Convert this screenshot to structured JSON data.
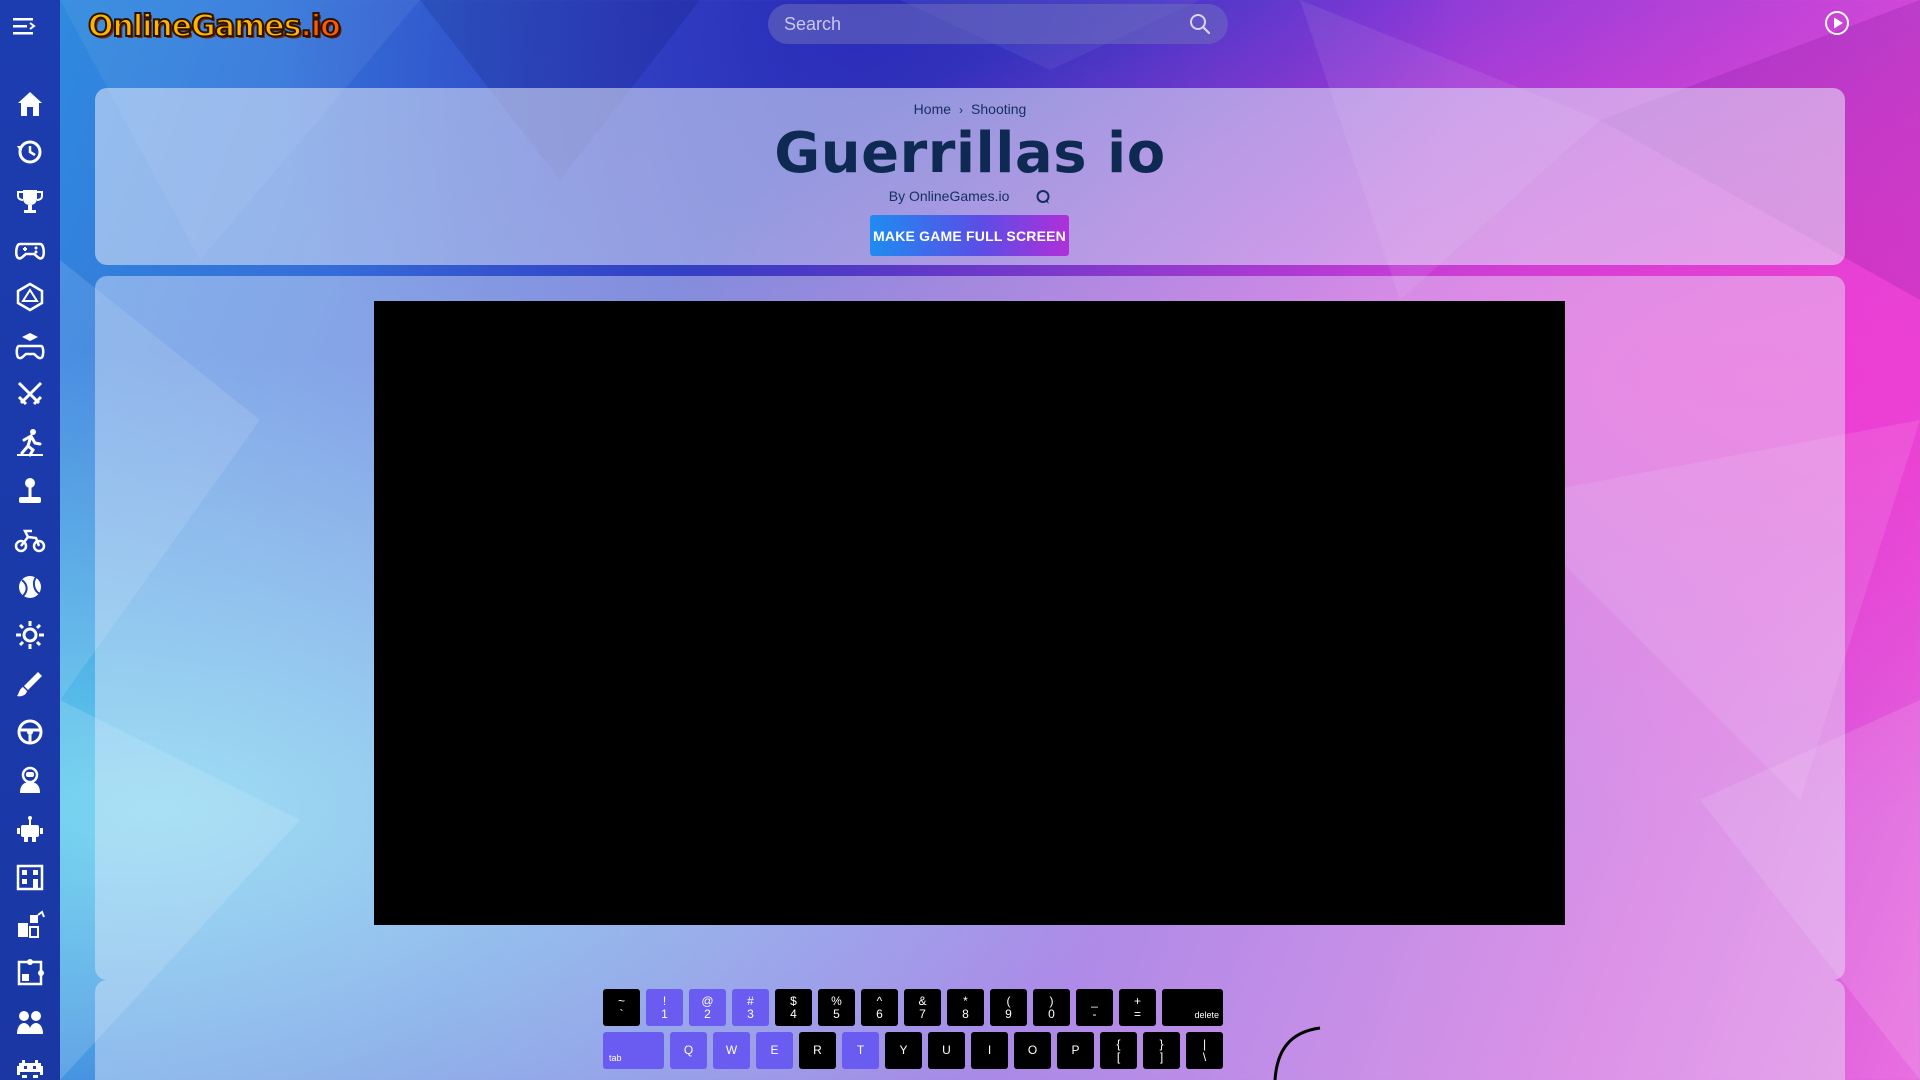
{
  "header": {
    "logo_main": "OnlineGames",
    "logo_tld": ".io",
    "search_placeholder": "Search"
  },
  "sidebar": {
    "items": [
      {
        "icon": "home-icon"
      },
      {
        "icon": "history-icon"
      },
      {
        "icon": "trophy-icon"
      },
      {
        "icon": "gamepad-icon"
      },
      {
        "icon": "d20-dice-icon"
      },
      {
        "icon": "gamepad-cube-icon"
      },
      {
        "icon": "crossed-swords-icon"
      },
      {
        "icon": "runner-icon"
      },
      {
        "icon": "joystick-icon"
      },
      {
        "icon": "motorbike-icon"
      },
      {
        "icon": "ball-icon"
      },
      {
        "icon": "gear-icon"
      },
      {
        "icon": "brush-icon"
      },
      {
        "icon": "steering-wheel-icon"
      },
      {
        "icon": "astronaut-icon"
      },
      {
        "icon": "robot-icon"
      },
      {
        "icon": "building-icon"
      },
      {
        "icon": "blocks-icon"
      },
      {
        "icon": "puzzle-icon"
      },
      {
        "icon": "people-icon"
      },
      {
        "icon": "space-invader-icon"
      }
    ]
  },
  "breadcrumb": {
    "home": "Home",
    "separator": "›",
    "category": "Shooting"
  },
  "game": {
    "title": "Guerrillas io",
    "byline": "By OnlineGames.io",
    "fullscreen_label": "MAKE GAME FULL SCREEN"
  },
  "keyboard": {
    "row1": [
      {
        "top": "~",
        "bottom": "`",
        "hl": false
      },
      {
        "top": "!",
        "bottom": "1",
        "hl": true
      },
      {
        "top": "@",
        "bottom": "2",
        "hl": true
      },
      {
        "top": "#",
        "bottom": "3",
        "hl": true
      },
      {
        "top": "$",
        "bottom": "4",
        "hl": false
      },
      {
        "top": "%",
        "bottom": "5",
        "hl": false
      },
      {
        "top": "^",
        "bottom": "6",
        "hl": false
      },
      {
        "top": "&",
        "bottom": "7",
        "hl": false
      },
      {
        "top": "*",
        "bottom": "8",
        "hl": false
      },
      {
        "top": "(",
        "bottom": "9",
        "hl": false
      },
      {
        "top": ")",
        "bottom": "0",
        "hl": false
      },
      {
        "top": "_",
        "bottom": "-",
        "hl": false
      },
      {
        "top": "+",
        "bottom": "=",
        "hl": false
      }
    ],
    "delete_label": "delete",
    "tab_label": "tab",
    "row2": [
      {
        "top": "",
        "bottom": "Q",
        "hl": true
      },
      {
        "top": "",
        "bottom": "W",
        "hl": true
      },
      {
        "top": "",
        "bottom": "E",
        "hl": true
      },
      {
        "top": "",
        "bottom": "R",
        "hl": false
      },
      {
        "top": "",
        "bottom": "T",
        "hl": true
      },
      {
        "top": "",
        "bottom": "Y",
        "hl": false
      },
      {
        "top": "",
        "bottom": "U",
        "hl": false
      },
      {
        "top": "",
        "bottom": "I",
        "hl": false
      },
      {
        "top": "",
        "bottom": "O",
        "hl": false
      },
      {
        "top": "",
        "bottom": "P",
        "hl": false
      },
      {
        "top": "{",
        "bottom": "[",
        "hl": false
      },
      {
        "top": "}",
        "bottom": "]",
        "hl": false
      },
      {
        "top": "|",
        "bottom": "\\",
        "hl": false
      }
    ]
  },
  "colors": {
    "sidebar": "#1c3db0",
    "title_text": "#0e2a52",
    "key_highlight": "#6a5cf0",
    "key_default": "#000000"
  }
}
